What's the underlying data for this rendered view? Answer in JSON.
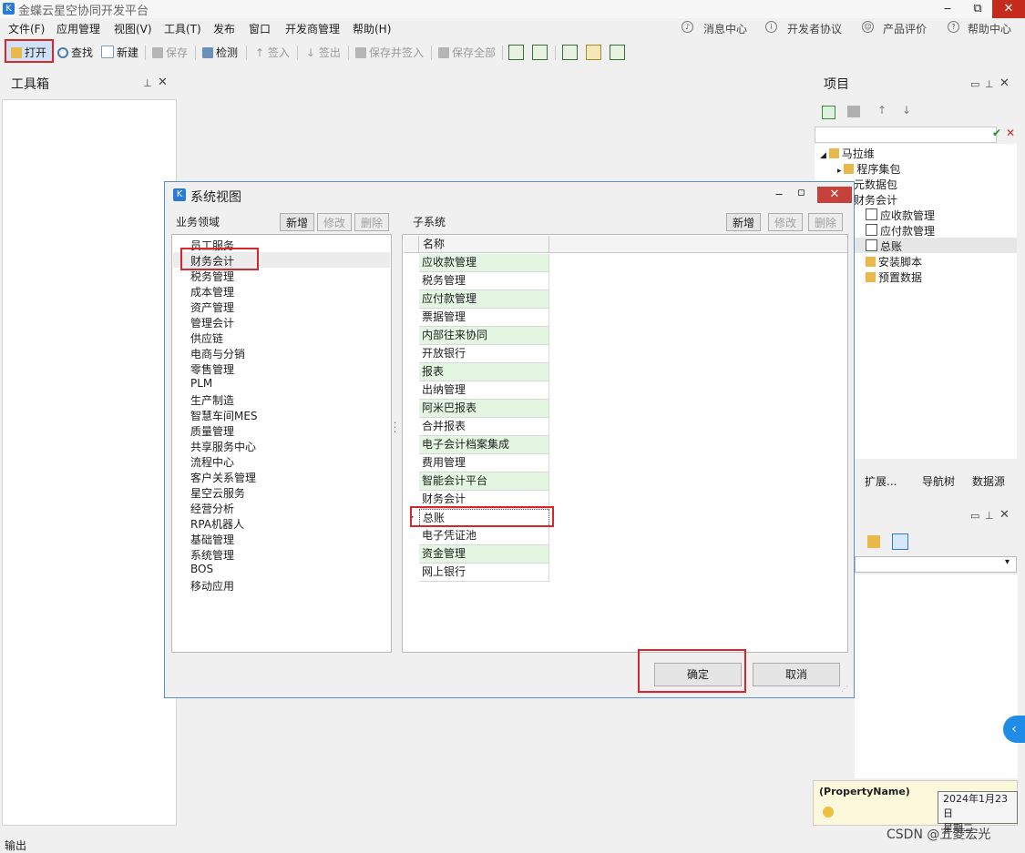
{
  "app": {
    "title": "金蝶云星空协同开发平台",
    "icon_letter": "K"
  },
  "window_controls": {
    "minimize": "‒",
    "restore": "⧉",
    "close": "✕"
  },
  "menubar": {
    "items": [
      "文件(F)",
      "应用管理",
      "视图(V)",
      "工具(T)",
      "发布",
      "窗口",
      "开发商管理",
      "帮助(H)"
    ],
    "right": [
      "消息中心",
      "开发者协议",
      "产品评价",
      "帮助中心"
    ]
  },
  "toolbar": {
    "open": "打开",
    "find": "查找",
    "new": "新建",
    "save": "保存",
    "check": "检测",
    "checkin": "签入",
    "checkout": "签出",
    "save_checkin": "保存并签入",
    "save_all": "保存全部"
  },
  "toolbox": {
    "title": "工具箱"
  },
  "project": {
    "title": "项目",
    "tree": [
      "马拉维",
      "程序集包",
      "元数据包",
      "财务会计",
      "应收款管理",
      "应付款管理",
      "总账",
      "安装脚本",
      "预置数据"
    ],
    "tabs": [
      "扩展...",
      "导航树",
      "数据源"
    ]
  },
  "props": {
    "property_name": "(PropertyName)"
  },
  "tooltip": {
    "date": "2024年1月23日",
    "weekday": "星期二"
  },
  "dialog": {
    "title": "系统视图",
    "left_label": "业务领域",
    "right_label": "子系统",
    "btn_add": "新增",
    "btn_edit": "修改",
    "btn_delete": "删除",
    "column_name": "名称",
    "domains": [
      "员工服务",
      "财务会计",
      "税务管理",
      "成本管理",
      "资产管理",
      "管理会计",
      "供应链",
      "电商与分销",
      "零售管理",
      "PLM",
      "生产制造",
      "智慧车间MES",
      "质量管理",
      "共享服务中心",
      "流程中心",
      "客户关系管理",
      "星空云服务",
      "经营分析",
      "RPA机器人",
      "基础管理",
      "系统管理",
      "BOS",
      "移动应用"
    ],
    "subsystems": [
      "应收款管理",
      "税务管理",
      "应付款管理",
      "票据管理",
      "内部往来协同",
      "开放银行",
      "报表",
      "出纳管理",
      "阿米巴报表",
      "合并报表",
      "电子会计档案集成",
      "费用管理",
      "智能会计平台",
      "财务会计",
      "总账",
      "电子凭证池",
      "资金管理",
      "网上银行"
    ],
    "selected_domain": "财务会计",
    "selected_subsystem": "总账",
    "ok": "确定",
    "cancel": "取消"
  },
  "status": {
    "output": "输出"
  },
  "watermark": "CSDN @五菱宏光",
  "colors": {
    "highlight_red": "#d9262c",
    "green_row": "#e2f6e2",
    "accent_blue": "#2a7bd8"
  }
}
